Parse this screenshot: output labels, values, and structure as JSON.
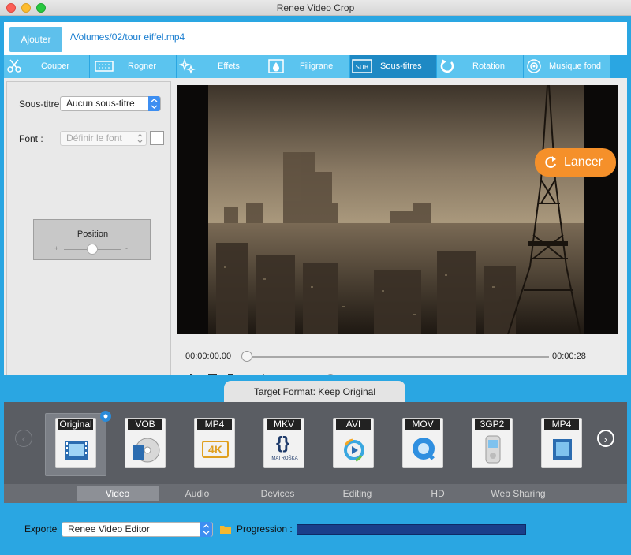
{
  "window": {
    "title": "Renee Video Crop"
  },
  "header": {
    "add_button": "Ajouter",
    "file_path": "/Volumes/02/tour eiffel.mp4"
  },
  "tabs": [
    {
      "label": "Couper",
      "icon": "scissors-icon"
    },
    {
      "label": "Rogner",
      "icon": "crop-icon"
    },
    {
      "label": "Effets",
      "icon": "sparkle-icon"
    },
    {
      "label": "Filigrane",
      "icon": "watermark-icon"
    },
    {
      "label": "Sous-titres",
      "icon": "subtitle-icon",
      "active": true
    },
    {
      "label": "Rotation",
      "icon": "rotate-icon"
    },
    {
      "label": "Musique fond",
      "icon": "music-icon"
    }
  ],
  "left_panel": {
    "subtitle_label": "Sous-titre",
    "subtitle_value": "Aucun sous-titre",
    "font_label": "Font :",
    "font_placeholder": "Définir le font",
    "position_label": "Position",
    "position_minus": "+",
    "position_plus": "-"
  },
  "player": {
    "time_current": "00:00:00.00",
    "time_total": "00:00:28",
    "progress": 0
  },
  "formats": {
    "tab_label": "Target Format: Keep Original",
    "items": [
      {
        "label": "Original",
        "selected": true
      },
      {
        "label": "VOB"
      },
      {
        "label": "MP4",
        "sub": "4K"
      },
      {
        "label": "MKV",
        "sub": "MATROŠKA"
      },
      {
        "label": "AVI"
      },
      {
        "label": "MOV"
      },
      {
        "label": "3GP2"
      },
      {
        "label": "MP4"
      }
    ],
    "categories": [
      "Video",
      "Audio",
      "Devices",
      "Editing",
      "HD",
      "Web Sharing"
    ]
  },
  "footer": {
    "export_label": "Exporte",
    "export_value": "Renee Video Editor",
    "progress_label": "Progression :",
    "launch_button": "Lancer"
  },
  "colors": {
    "accent": "#2aa6e2",
    "launch": "#f5902a",
    "active_tab": "#1e89c4"
  }
}
